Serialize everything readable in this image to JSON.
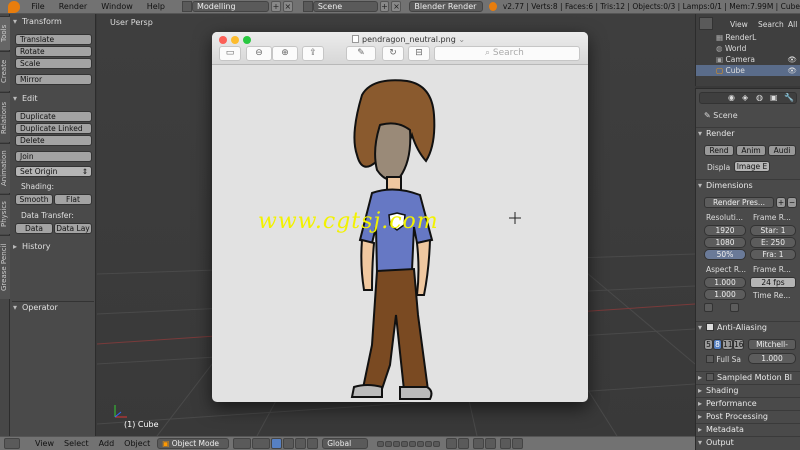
{
  "topbar": {
    "menus": [
      "File",
      "Render",
      "Window",
      "Help"
    ],
    "layout": "Modelling",
    "scene": "Scene",
    "engine": "Blender Render",
    "stats": "v2.77 | Verts:8 | Faces:6 | Tris:12 | Objects:0/3 | Lamps:0/1 | Mem:7.99M | Cube"
  },
  "tabs": [
    "Tools",
    "Create",
    "Relations",
    "Animation",
    "Physics",
    "Grease Pencil"
  ],
  "tool_shelf": {
    "transform_header": "Transform",
    "translate": "Translate",
    "rotate": "Rotate",
    "scale": "Scale",
    "mirror": "Mirror",
    "edit_header": "Edit",
    "duplicate": "Duplicate",
    "duplicate_linked": "Duplicate Linked",
    "delete": "Delete",
    "join": "Join",
    "set_origin": "Set Origin",
    "shading_label": "Shading:",
    "smooth": "Smooth",
    "flat": "Flat",
    "data_transfer_label": "Data Transfer:",
    "data": "Data",
    "data_lay": "Data Lay",
    "history_header": "History",
    "operator_header": "Operator"
  },
  "viewport": {
    "view_label": "User Persp",
    "object_label": "(1) Cube",
    "watermark": "www.cgtsj.com",
    "watermark_color": "#f2f200"
  },
  "preview": {
    "title": "pendragon_neutral.png",
    "search_placeholder": "Search"
  },
  "outliner": {
    "view": "View",
    "search": "Search",
    "all": "All",
    "rows": [
      "RenderL",
      "World",
      "Camera",
      "Cube"
    ]
  },
  "properties": {
    "scene": "Scene",
    "render_header": "Render",
    "render_btn": "Rend",
    "anim_btn": "Anim",
    "audio_btn": "Audi",
    "display_label": "Displa",
    "display_value": "Image E",
    "dimensions_header": "Dimensions",
    "render_presets": "Render Pres...",
    "resolution_label": "Resoluti...",
    "frame_range_label": "Frame R...",
    "res_x": "1920",
    "res_y": "1080",
    "res_pct": "50%",
    "frame_start": "Star: 1",
    "frame_end": "E: 250",
    "frame_step": "Fra: 1",
    "aspect_label": "Aspect R...",
    "frame_rate_label": "Frame R...",
    "aspect_x": "1.000",
    "aspect_y": "1.000",
    "fps": "24 fps",
    "time_remap_label": "Time Re...",
    "aa_header": "Anti-Aliasing",
    "aa_samples": [
      "5",
      "8",
      "11",
      "16"
    ],
    "aa_filter": "Mitchell-",
    "full_sample": "Full Sa",
    "filter_size": "1.000",
    "sampled_motion_blur": "Sampled Motion Bl",
    "shading_header": "Shading",
    "performance_header": "Performance",
    "post_processing_header": "Post Processing",
    "metadata_header": "Metadata",
    "output_header": "Output"
  },
  "bottombar": {
    "menus": [
      "View",
      "Select",
      "Add",
      "Object"
    ],
    "mode": "Object Mode",
    "orientation": "Global"
  }
}
